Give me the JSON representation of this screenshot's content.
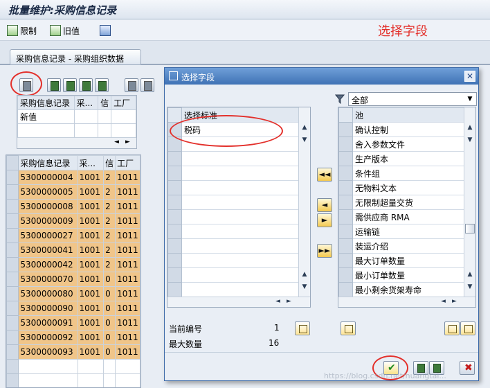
{
  "window": {
    "title": "批量维护:采购信息记录"
  },
  "toolbar": {
    "limit_label": "限制",
    "old_value_label": "旧值"
  },
  "annotation": {
    "label": "选择字段"
  },
  "tab": {
    "label": "采购信息记录 - 采购组织数据"
  },
  "mini_table": {
    "headers": [
      "采购信息记录",
      "采...",
      "信",
      "工厂"
    ],
    "row_label": "新值"
  },
  "main_table": {
    "headers": [
      "采购信息记录",
      "采...",
      "信",
      "工厂"
    ],
    "rows": [
      [
        "5300000004",
        "1001",
        "2",
        "1011"
      ],
      [
        "5300000005",
        "1001",
        "2",
        "1011"
      ],
      [
        "5300000008",
        "1001",
        "2",
        "1011"
      ],
      [
        "5300000009",
        "1001",
        "2",
        "1011"
      ],
      [
        "5300000027",
        "1001",
        "2",
        "1011"
      ],
      [
        "5300000041",
        "1001",
        "2",
        "1011"
      ],
      [
        "5300000042",
        "1001",
        "2",
        "1011"
      ],
      [
        "5300000070",
        "1001",
        "0",
        "1011"
      ],
      [
        "5300000080",
        "1001",
        "0",
        "1011"
      ],
      [
        "5300000090",
        "1001",
        "0",
        "1011"
      ],
      [
        "5300000091",
        "1001",
        "0",
        "1011"
      ],
      [
        "5300000092",
        "1001",
        "0",
        "1011"
      ],
      [
        "5300000093",
        "1001",
        "0",
        "1011"
      ]
    ]
  },
  "dialog": {
    "title": "选择字段",
    "left_header": "选择标准",
    "left_items": [
      "税码"
    ],
    "filter_value": "全部",
    "right_header": "池",
    "right_items": [
      "确认控制",
      "舍入参数文件",
      "生产版本",
      "条件组",
      "无物料文本",
      "无限制超量交货",
      "需供应商 RMA",
      "运输链",
      "装运介绍",
      "最大订单数量",
      "最小订单数量",
      "最小剩余货架寿命"
    ],
    "current_no_label": "当前编号",
    "current_no_value": "1",
    "max_qty_label": "最大数量",
    "max_qty_value": "16"
  },
  "watermark": "https://blog.csdn.net/huangtai..."
}
